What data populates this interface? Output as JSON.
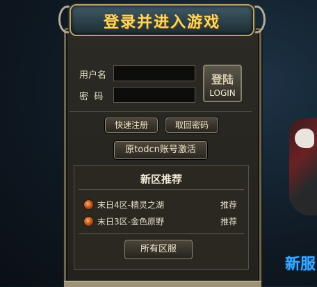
{
  "title": "登录并进入游戏",
  "form": {
    "username_label": "用户名",
    "password_label": "密  码",
    "username_value": "",
    "password_value": ""
  },
  "login_button": {
    "cn": "登陆",
    "en": "LOGIN"
  },
  "buttons": {
    "register": "快速注册",
    "recover": "取回密码",
    "activate": "原todcn账号激活"
  },
  "servers": {
    "title": "新区推荐",
    "items": [
      {
        "name": "末日4区-精灵之湖",
        "tag": "推荐"
      },
      {
        "name": "末日3区-金色原野",
        "tag": "推荐"
      }
    ],
    "all_button": "所有区服"
  },
  "background": {
    "banner_text": "新服"
  }
}
